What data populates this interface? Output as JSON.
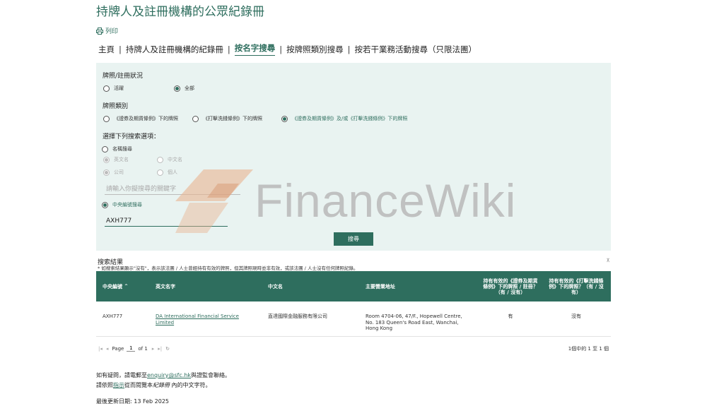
{
  "page": {
    "title": "持牌人及註冊機構的公眾紀錄冊",
    "print_label": "列印"
  },
  "nav": {
    "items": [
      {
        "label": "主頁"
      },
      {
        "label": "持牌人及註冊機構的紀錄冊"
      },
      {
        "label": "按名字搜尋",
        "active": true
      },
      {
        "label": "按牌照類別搜尋"
      },
      {
        "label": "按若干業務活動搜尋（只限法團）"
      }
    ],
    "separator": "|"
  },
  "form": {
    "status": {
      "label": "牌照/註冊狀況",
      "options": [
        {
          "label": "活躍",
          "checked": false
        },
        {
          "label": "全部",
          "checked": true
        }
      ]
    },
    "licence_type": {
      "label": "牌照類別",
      "options": [
        {
          "label": "《證券及期貨條例》下的牌照",
          "checked": false
        },
        {
          "label": "《打擊洗錢條例》下的牌照",
          "checked": false
        },
        {
          "label": "《證券及期貨條例》及/或《打擊洗錢條例》下的牌照",
          "checked": true
        }
      ]
    },
    "search_option": {
      "label": "選擇下列搜索選項：",
      "name_search": {
        "label": "名稱搜尋",
        "checked": false
      },
      "name_lang": [
        {
          "label": "英文名",
          "checked": true
        },
        {
          "label": "中文名",
          "checked": false
        }
      ],
      "entity_type": [
        {
          "label": "公司",
          "checked": true
        },
        {
          "label": "個人",
          "checked": false
        }
      ],
      "keyword_placeholder": "請輸入你擬搜尋的關鍵字",
      "ce_search": {
        "label": "中央編號搜尋",
        "checked": true
      },
      "ce_value": "AXH777"
    },
    "search_button": "搜尋"
  },
  "watermark": {
    "text": "FinanceWiki"
  },
  "results": {
    "title": "搜索結果",
    "note": "* 如搜索結果顯示\"沒有\"，表示該法團 / 人士曾經持有有效的牌照，但其牌照現時並非有效，或該法團 / 人士沒有任何牌照紀錄。",
    "collapse_icon": "⊼",
    "columns": [
      "中央編號",
      "英文名字",
      "中文名",
      "主要營業地址",
      "持有有效的《證券及期貨條例》下的牌照 / 註冊？（有 / 沒有）",
      "持有有效的《打擊洗錢條例》下的牌照？（有 / 沒有）"
    ],
    "sort_indicator": "^",
    "rows": [
      {
        "ce": "AXH777",
        "en_name": "DA International Financial Service Limited",
        "cn_name": "直達國際金融服務有限公司",
        "address": "Room 4704-06, 47/F., Hopewell Centre, No. 183 Queen's Road East, Wanchai, Hong Kong",
        "sfo": "有",
        "amlo": "沒有"
      }
    ],
    "pager": {
      "page_label": "Page",
      "page": "1",
      "of_label": "of 1",
      "summary": "1個中的 1 至 1 個"
    }
  },
  "footer": {
    "enquiry_prefix": "如有疑問，請電郵至",
    "enquiry_email": "enquiry@sfc.hk",
    "enquiry_suffix": "與證監會聯絡。",
    "guide_prefix": "請依照",
    "guide_link": "指示",
    "guide_mid": "從而閱覽本",
    "guide_italic": "紀錄冊",
    "guide_suffix": " 內的中文字符。",
    "last_updated": "最後更新日期: 13 Feb 2025"
  }
}
